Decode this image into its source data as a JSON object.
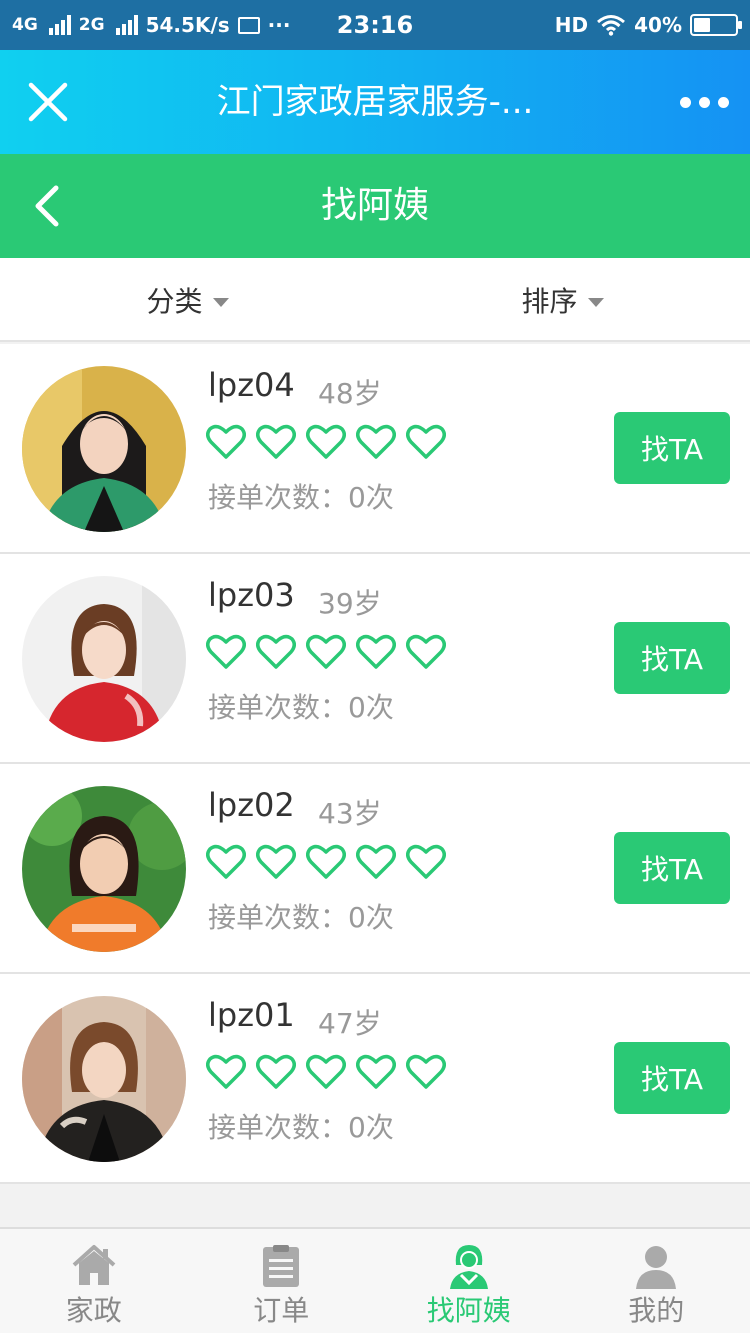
{
  "status_bar": {
    "network_1": "4G",
    "network_2": "2G",
    "speed": "54.5K/s",
    "more": "···",
    "time": "23:16",
    "hd": "HD",
    "battery": "40%",
    "battery_level": 0.4
  },
  "wechat_bar": {
    "title": "江门家政居家服务-...",
    "close_icon": "close-icon",
    "more_icon": "more-dots-icon"
  },
  "header": {
    "title": "找阿姨",
    "back_icon": "back-chevron-icon"
  },
  "filters": [
    {
      "label": "分类"
    },
    {
      "label": "排序"
    }
  ],
  "workers": [
    {
      "name": "lpz04",
      "age": "48岁",
      "rating": 5,
      "orders": "接单次数：0次",
      "button": "找TA"
    },
    {
      "name": "lpz03",
      "age": "39岁",
      "rating": 5,
      "orders": "接单次数：0次",
      "button": "找TA"
    },
    {
      "name": "lpz02",
      "age": "43岁",
      "rating": 5,
      "orders": "接单次数：0次",
      "button": "找TA"
    },
    {
      "name": "lpz01",
      "age": "47岁",
      "rating": 5,
      "orders": "接单次数：0次",
      "button": "找TA"
    }
  ],
  "tabbar": [
    {
      "label": "家政",
      "icon": "home-icon",
      "active": false
    },
    {
      "label": "订单",
      "icon": "clipboard-icon",
      "active": false
    },
    {
      "label": "找阿姨",
      "icon": "worker-icon",
      "active": true
    },
    {
      "label": "我的",
      "icon": "user-icon",
      "active": false
    }
  ],
  "colors": {
    "primary_green": "#2ac975",
    "wechat_blue_start": "#10d0f0",
    "wechat_blue_end": "#1592f3",
    "status_bar": "#1e6fa3"
  }
}
